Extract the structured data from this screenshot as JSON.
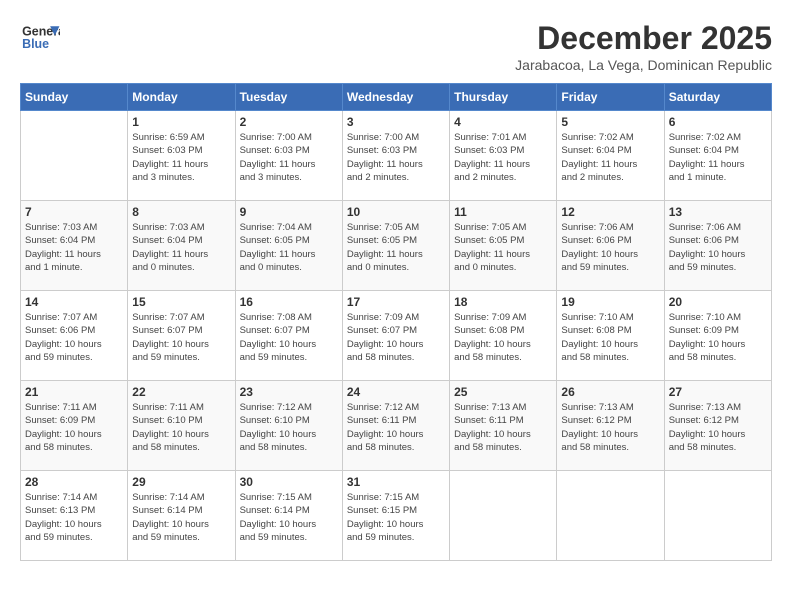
{
  "header": {
    "logo_line1": "General",
    "logo_line2": "Blue",
    "month": "December 2025",
    "location": "Jarabacoa, La Vega, Dominican Republic"
  },
  "weekdays": [
    "Sunday",
    "Monday",
    "Tuesday",
    "Wednesday",
    "Thursday",
    "Friday",
    "Saturday"
  ],
  "weeks": [
    [
      {
        "day": "",
        "content": ""
      },
      {
        "day": "1",
        "content": "Sunrise: 6:59 AM\nSunset: 6:03 PM\nDaylight: 11 hours\nand 3 minutes."
      },
      {
        "day": "2",
        "content": "Sunrise: 7:00 AM\nSunset: 6:03 PM\nDaylight: 11 hours\nand 3 minutes."
      },
      {
        "day": "3",
        "content": "Sunrise: 7:00 AM\nSunset: 6:03 PM\nDaylight: 11 hours\nand 2 minutes."
      },
      {
        "day": "4",
        "content": "Sunrise: 7:01 AM\nSunset: 6:03 PM\nDaylight: 11 hours\nand 2 minutes."
      },
      {
        "day": "5",
        "content": "Sunrise: 7:02 AM\nSunset: 6:04 PM\nDaylight: 11 hours\nand 2 minutes."
      },
      {
        "day": "6",
        "content": "Sunrise: 7:02 AM\nSunset: 6:04 PM\nDaylight: 11 hours\nand 1 minute."
      }
    ],
    [
      {
        "day": "7",
        "content": "Sunrise: 7:03 AM\nSunset: 6:04 PM\nDaylight: 11 hours\nand 1 minute."
      },
      {
        "day": "8",
        "content": "Sunrise: 7:03 AM\nSunset: 6:04 PM\nDaylight: 11 hours\nand 0 minutes."
      },
      {
        "day": "9",
        "content": "Sunrise: 7:04 AM\nSunset: 6:05 PM\nDaylight: 11 hours\nand 0 minutes."
      },
      {
        "day": "10",
        "content": "Sunrise: 7:05 AM\nSunset: 6:05 PM\nDaylight: 11 hours\nand 0 minutes."
      },
      {
        "day": "11",
        "content": "Sunrise: 7:05 AM\nSunset: 6:05 PM\nDaylight: 11 hours\nand 0 minutes."
      },
      {
        "day": "12",
        "content": "Sunrise: 7:06 AM\nSunset: 6:06 PM\nDaylight: 10 hours\nand 59 minutes."
      },
      {
        "day": "13",
        "content": "Sunrise: 7:06 AM\nSunset: 6:06 PM\nDaylight: 10 hours\nand 59 minutes."
      }
    ],
    [
      {
        "day": "14",
        "content": "Sunrise: 7:07 AM\nSunset: 6:06 PM\nDaylight: 10 hours\nand 59 minutes."
      },
      {
        "day": "15",
        "content": "Sunrise: 7:07 AM\nSunset: 6:07 PM\nDaylight: 10 hours\nand 59 minutes."
      },
      {
        "day": "16",
        "content": "Sunrise: 7:08 AM\nSunset: 6:07 PM\nDaylight: 10 hours\nand 59 minutes."
      },
      {
        "day": "17",
        "content": "Sunrise: 7:09 AM\nSunset: 6:07 PM\nDaylight: 10 hours\nand 58 minutes."
      },
      {
        "day": "18",
        "content": "Sunrise: 7:09 AM\nSunset: 6:08 PM\nDaylight: 10 hours\nand 58 minutes."
      },
      {
        "day": "19",
        "content": "Sunrise: 7:10 AM\nSunset: 6:08 PM\nDaylight: 10 hours\nand 58 minutes."
      },
      {
        "day": "20",
        "content": "Sunrise: 7:10 AM\nSunset: 6:09 PM\nDaylight: 10 hours\nand 58 minutes."
      }
    ],
    [
      {
        "day": "21",
        "content": "Sunrise: 7:11 AM\nSunset: 6:09 PM\nDaylight: 10 hours\nand 58 minutes."
      },
      {
        "day": "22",
        "content": "Sunrise: 7:11 AM\nSunset: 6:10 PM\nDaylight: 10 hours\nand 58 minutes."
      },
      {
        "day": "23",
        "content": "Sunrise: 7:12 AM\nSunset: 6:10 PM\nDaylight: 10 hours\nand 58 minutes."
      },
      {
        "day": "24",
        "content": "Sunrise: 7:12 AM\nSunset: 6:11 PM\nDaylight: 10 hours\nand 58 minutes."
      },
      {
        "day": "25",
        "content": "Sunrise: 7:13 AM\nSunset: 6:11 PM\nDaylight: 10 hours\nand 58 minutes."
      },
      {
        "day": "26",
        "content": "Sunrise: 7:13 AM\nSunset: 6:12 PM\nDaylight: 10 hours\nand 58 minutes."
      },
      {
        "day": "27",
        "content": "Sunrise: 7:13 AM\nSunset: 6:12 PM\nDaylight: 10 hours\nand 58 minutes."
      }
    ],
    [
      {
        "day": "28",
        "content": "Sunrise: 7:14 AM\nSunset: 6:13 PM\nDaylight: 10 hours\nand 59 minutes."
      },
      {
        "day": "29",
        "content": "Sunrise: 7:14 AM\nSunset: 6:14 PM\nDaylight: 10 hours\nand 59 minutes."
      },
      {
        "day": "30",
        "content": "Sunrise: 7:15 AM\nSunset: 6:14 PM\nDaylight: 10 hours\nand 59 minutes."
      },
      {
        "day": "31",
        "content": "Sunrise: 7:15 AM\nSunset: 6:15 PM\nDaylight: 10 hours\nand 59 minutes."
      },
      {
        "day": "",
        "content": ""
      },
      {
        "day": "",
        "content": ""
      },
      {
        "day": "",
        "content": ""
      }
    ]
  ]
}
